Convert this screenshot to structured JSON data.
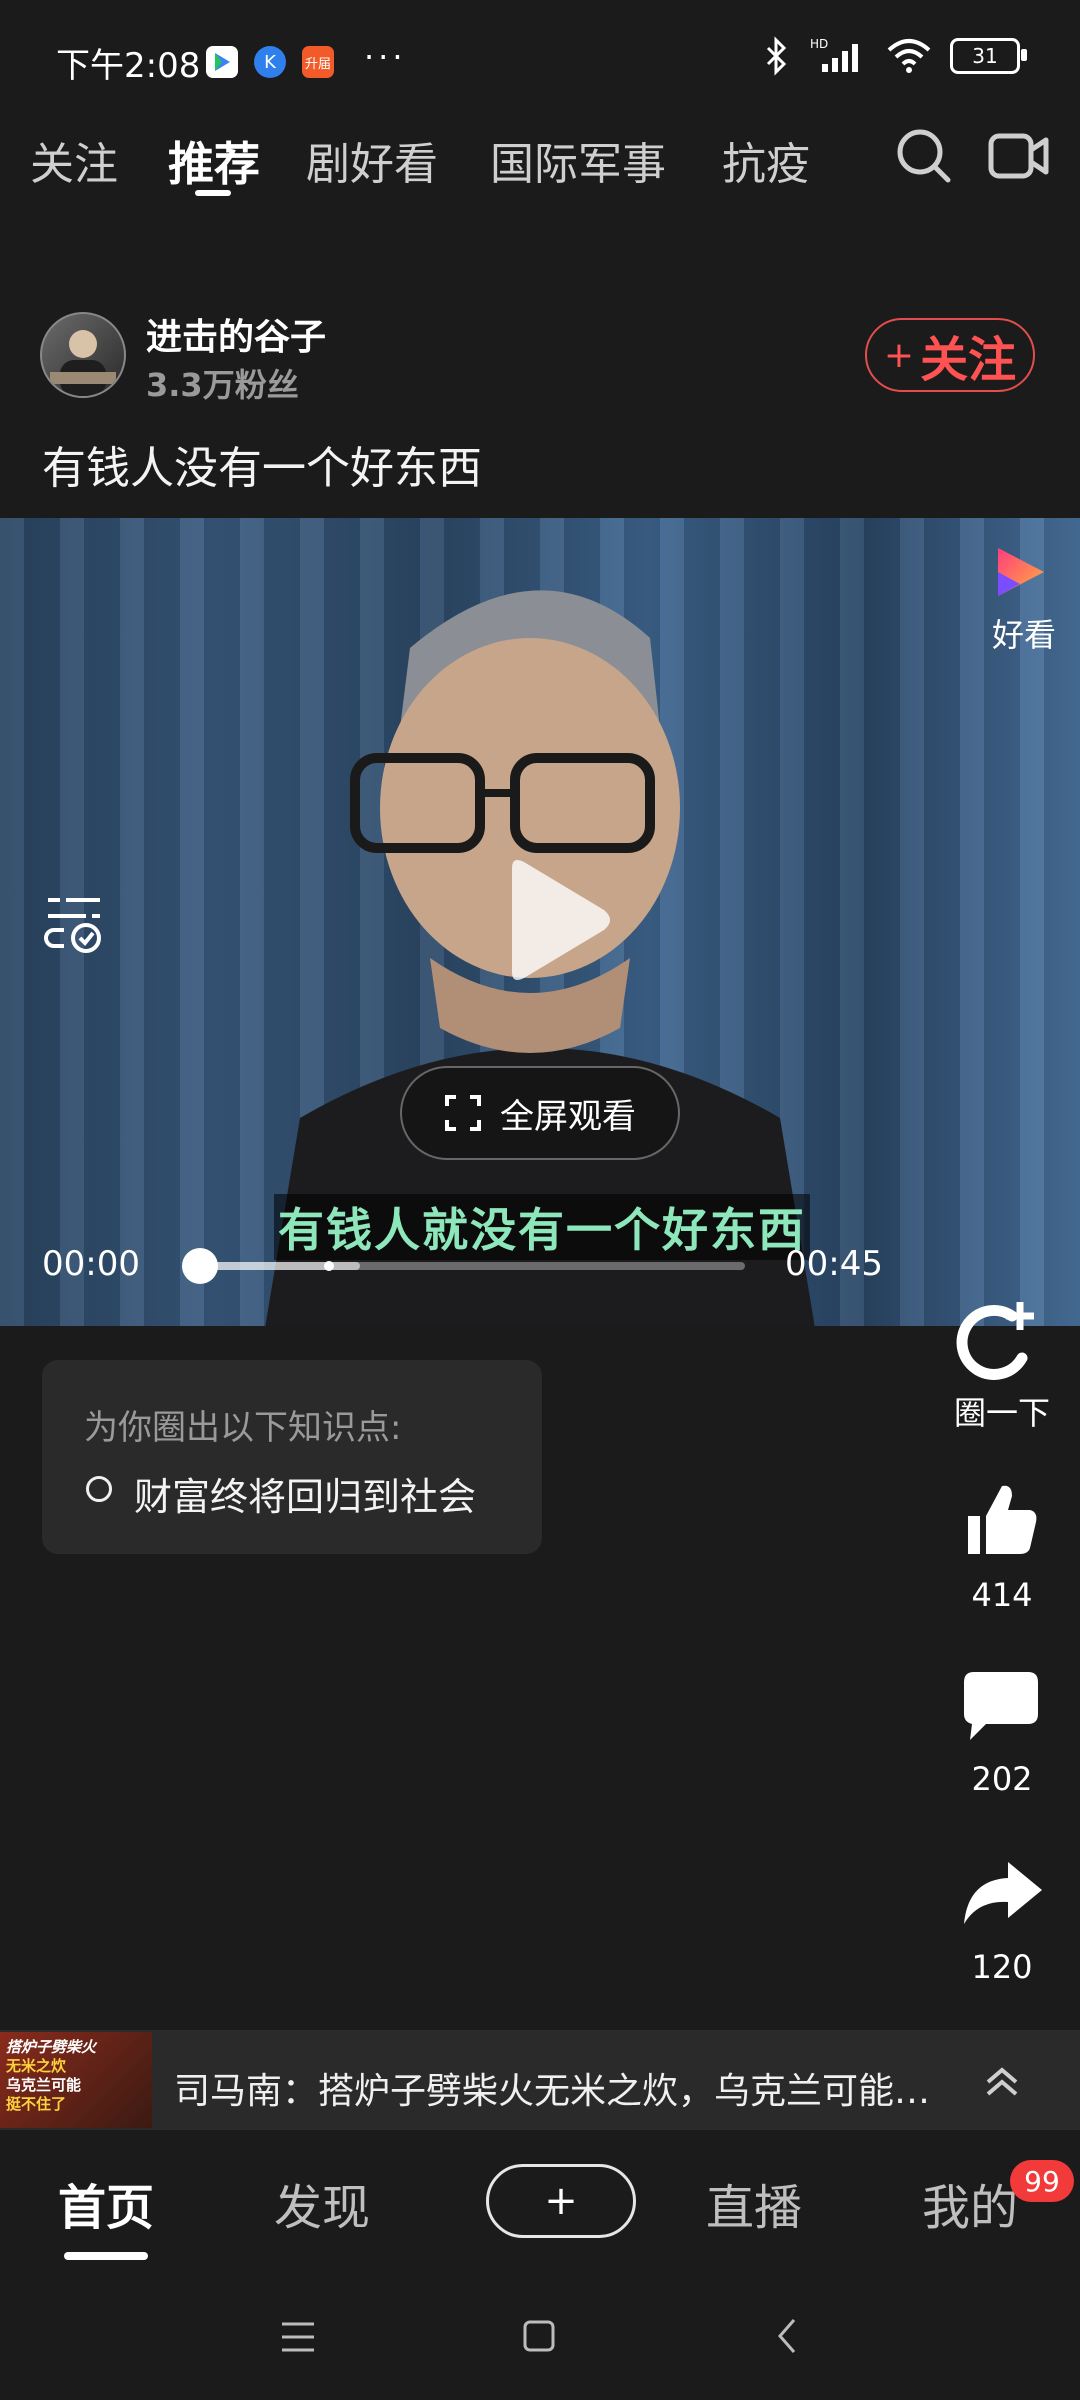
{
  "status_bar": {
    "time": "下午2:08",
    "more": "···",
    "battery": "31",
    "icons": [
      "play-store-icon",
      "k-app-icon",
      "mall-app-icon",
      "bluetooth-icon",
      "signal-icon",
      "wifi-icon",
      "battery-icon"
    ],
    "app_badge_text": "升届"
  },
  "top_tabs": {
    "items": [
      "关注",
      "推荐",
      "剧好看",
      "国际军事",
      "抗疫"
    ],
    "active_index": 1
  },
  "author": {
    "name": "进击的谷子",
    "fans": "3.3万粉丝",
    "follow_label": "关注",
    "follow_plus": "+"
  },
  "post": {
    "title": "有钱人没有一个好东西"
  },
  "video": {
    "logo_label": "好看",
    "fullscreen_label": "全屏观看",
    "caption": "有钱人就没有一个好东西",
    "time_current": "00:00",
    "time_total": "00:45",
    "progress_fraction": 0.0
  },
  "knowledge": {
    "heading": "为你圈出以下知识点:",
    "items": [
      "财富终将回归到社会"
    ]
  },
  "side_actions": {
    "circle_label": "圈一下",
    "likes": "414",
    "comments": "202",
    "shares": "120"
  },
  "news_banner": {
    "thumb_lines": [
      "搭炉子劈柴火",
      "无米之炊",
      "乌克兰可能",
      "挺不住了"
    ],
    "text": "司马南：搭炉子劈柴火无米之炊，乌克兰可能…"
  },
  "bottom_nav": {
    "items": [
      "首页",
      "发现",
      "+",
      "直播",
      "我的"
    ],
    "badge": "99"
  },
  "colors": {
    "background": "#1b1b1b",
    "accent_red": "#ff5252",
    "caption_green": "#8ee6bb",
    "badge_red": "#f33a3a"
  }
}
